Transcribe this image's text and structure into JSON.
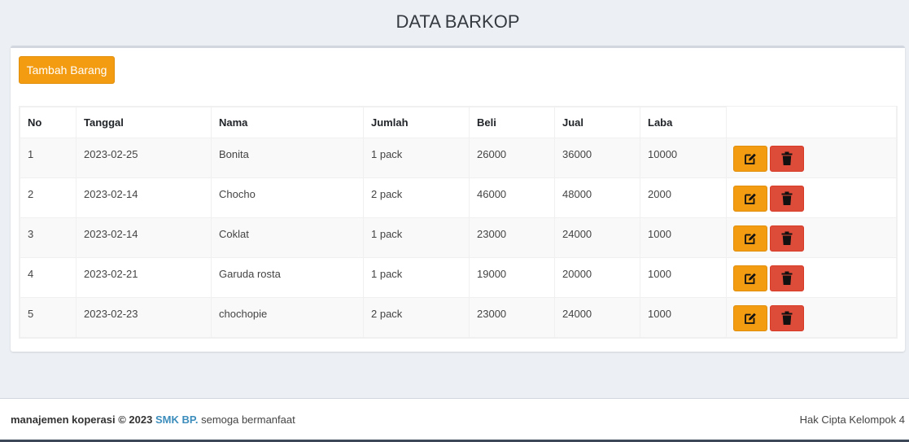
{
  "page": {
    "title": "DATA BARKOP"
  },
  "actions": {
    "add_label": "Tambah Barang"
  },
  "table": {
    "headers": [
      "No",
      "Tanggal",
      "Nama",
      "Jumlah",
      "Beli",
      "Jual",
      "Laba",
      ""
    ],
    "rows": [
      {
        "no": "1",
        "tanggal": "2023-02-25",
        "nama": "Bonita",
        "jumlah": "1 pack",
        "beli": "26000",
        "jual": "36000",
        "laba": "10000"
      },
      {
        "no": "2",
        "tanggal": "2023-02-14",
        "nama": "Chocho",
        "jumlah": "2 pack",
        "beli": "46000",
        "jual": "48000",
        "laba": "2000"
      },
      {
        "no": "3",
        "tanggal": "2023-02-14",
        "nama": "Coklat",
        "jumlah": "1 pack",
        "beli": "23000",
        "jual": "24000",
        "laba": "1000"
      },
      {
        "no": "4",
        "tanggal": "2023-02-21",
        "nama": "Garuda rosta",
        "jumlah": "1 pack",
        "beli": "19000",
        "jual": "20000",
        "laba": "1000"
      },
      {
        "no": "5",
        "tanggal": "2023-02-23",
        "nama": "chochopie",
        "jumlah": "2 pack",
        "beli": "23000",
        "jual": "24000",
        "laba": "1000"
      }
    ],
    "row_icons": {
      "edit": "edit-icon",
      "delete": "trash-icon"
    }
  },
  "footer": {
    "left_bold": "manajemen koperasi © 2023",
    "link": "SMK BP.",
    "left_tail": "semoga bermanfaat",
    "right": "Hak Cipta Kelompok 4"
  },
  "colors": {
    "warning": "#f39c12",
    "danger": "#dd4b39",
    "link": "#3c8dbc",
    "background": "#eceff4"
  }
}
